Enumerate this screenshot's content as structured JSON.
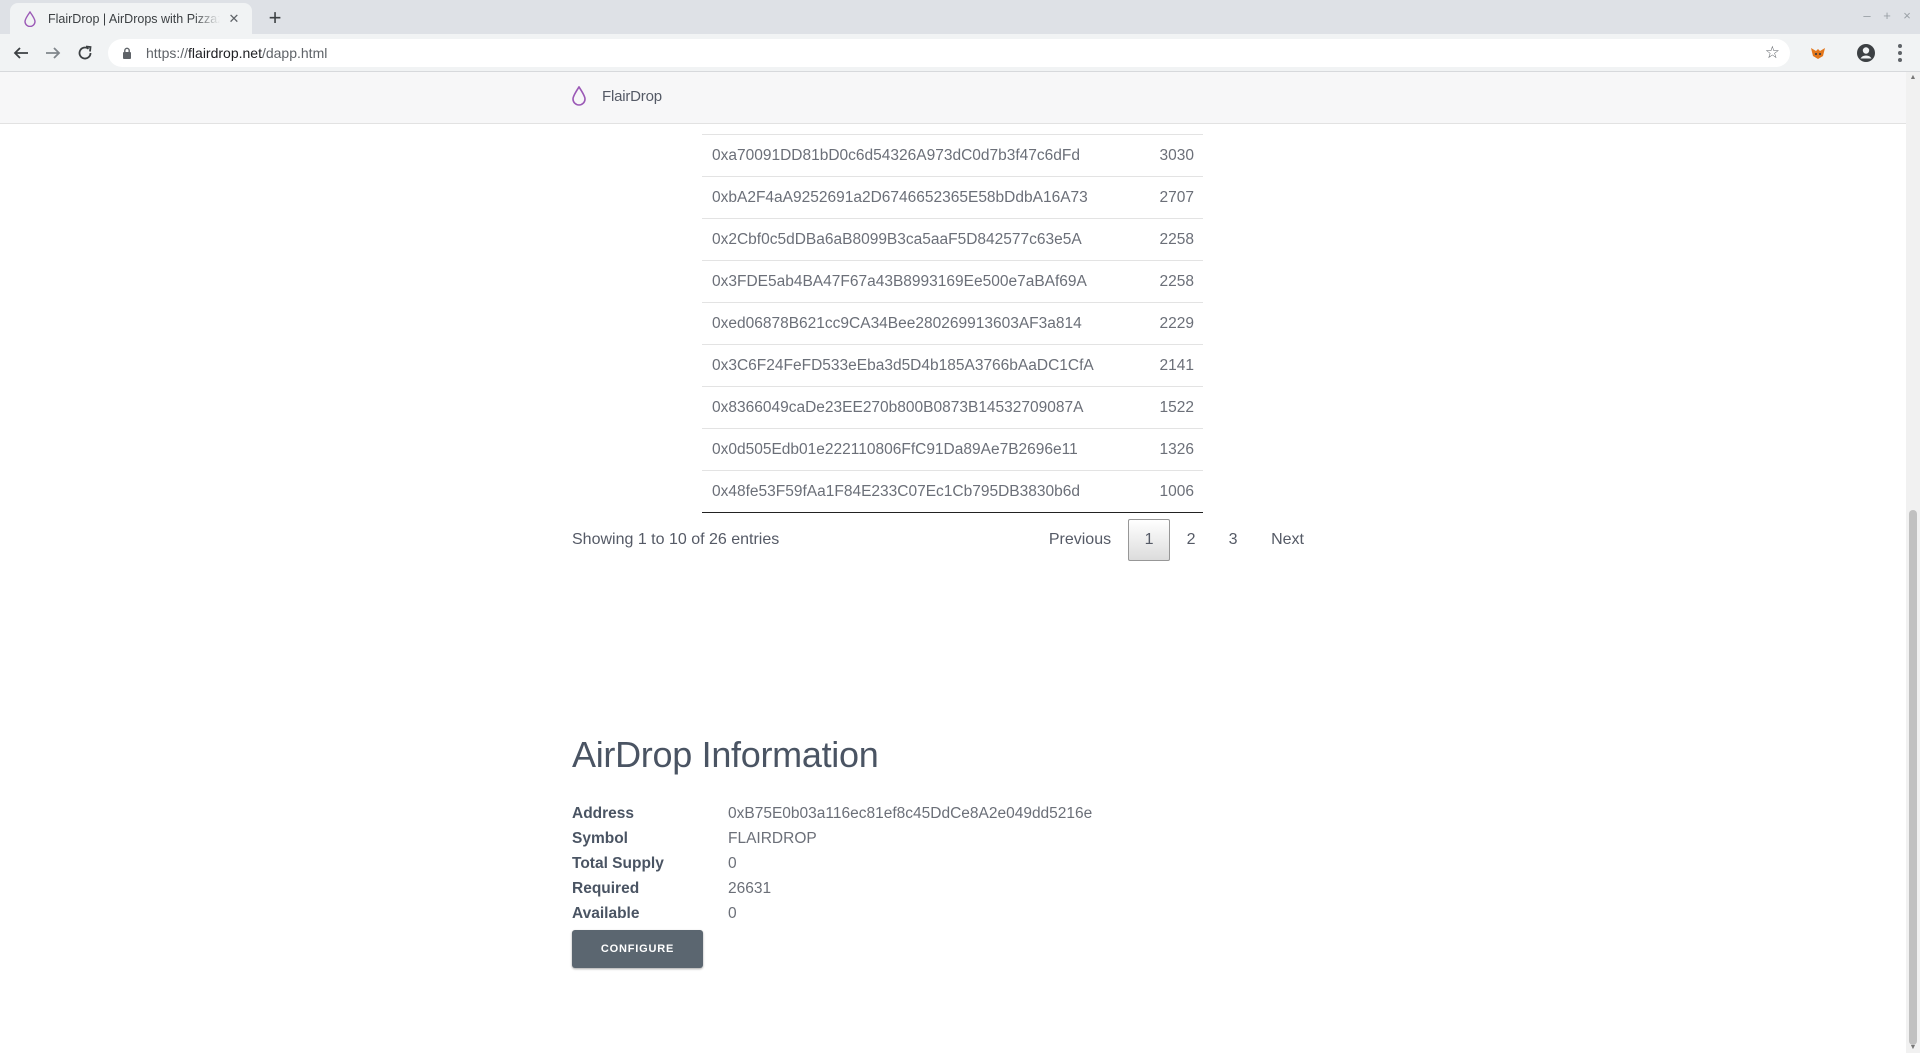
{
  "browser": {
    "tab_title": "FlairDrop | AirDrops with Pizzazz",
    "url_scheme": "https://",
    "url_host": "flairdrop.net",
    "url_path": "/dapp.html",
    "window_controls": [
      "–",
      "+",
      "×"
    ]
  },
  "navbar": {
    "brand": "FlairDrop"
  },
  "recipients": {
    "rows": [
      {
        "address": "0xa70091DD81bD0c6d54326A973dC0d7b3f47c6dFd",
        "amount": "3030"
      },
      {
        "address": "0xbA2F4aA9252691a2D6746652365E58bDdbA16A73",
        "amount": "2707"
      },
      {
        "address": "0x2Cbf0c5dDBa6aB8099B3ca5aaF5D842577c63e5A",
        "amount": "2258"
      },
      {
        "address": "0x3FDE5ab4BA47F67a43B8993169Ee500e7aBAf69A",
        "amount": "2258"
      },
      {
        "address": "0xed06878B621cc9CA34Bee280269913603AF3a814",
        "amount": "2229"
      },
      {
        "address": "0x3C6F24FeFD533eEba3d5D4b185A3766bAaDC1CfA",
        "amount": "2141"
      },
      {
        "address": "0x8366049caDe23EE270b800B0873B14532709087A",
        "amount": "1522"
      },
      {
        "address": "0x0d505Edb01e222110806FfC91Da89Ae7B2696e11",
        "amount": "1326"
      },
      {
        "address": "0x48fe53F59fAa1F84E233C07Ec1Cb795DB3830b6d",
        "amount": "1006"
      }
    ],
    "entries_info": "Showing 1 to 10 of 26 entries",
    "pagination": {
      "previous": "Previous",
      "pages": [
        "1",
        "2",
        "3"
      ],
      "current": "1",
      "next": "Next"
    }
  },
  "airdrop": {
    "title": "AirDrop Information",
    "fields": [
      {
        "label": "Address",
        "value": "0xB75E0b03a116ec81ef8c45DdCe8A2e049dd5216e"
      },
      {
        "label": "Symbol",
        "value": "FLAIRDROP"
      },
      {
        "label": "Total Supply",
        "value": "0"
      },
      {
        "label": "Required",
        "value": "26631"
      },
      {
        "label": "Available",
        "value": "0"
      }
    ],
    "configure_label": "CONFIGURE"
  },
  "colors": {
    "brand_purple": "#9b59b6",
    "button_bg": "#5b6670",
    "text_dark": "#4a5463"
  },
  "icons": [
    "droplet-icon",
    "close-icon",
    "plus-icon",
    "back-arrow-icon",
    "forward-arrow-icon",
    "reload-icon",
    "lock-icon",
    "star-icon",
    "extension-icon",
    "profile-icon",
    "menu-icon"
  ]
}
